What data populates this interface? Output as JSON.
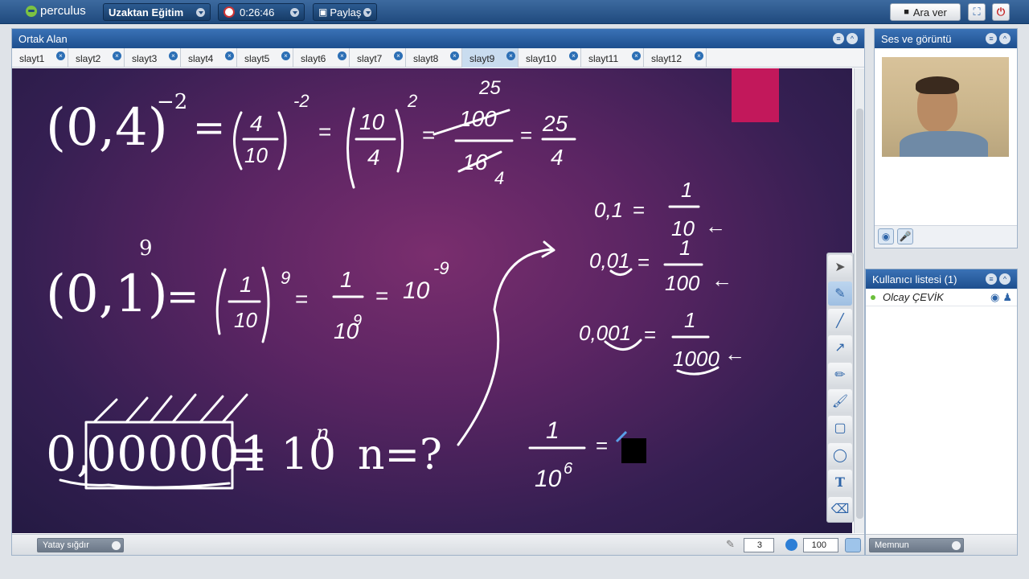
{
  "app": {
    "logo": "perculus"
  },
  "topbar": {
    "session_select": "Uzaktan Eğitim",
    "timer": "0:26:46",
    "share_label": "Paylaş",
    "break_label": "Ara ver"
  },
  "shared_area": {
    "title": "Ortak Alan",
    "tabs": [
      "slayt1",
      "slayt2",
      "slayt3",
      "slayt4",
      "slayt5",
      "slayt6",
      "slayt7",
      "slayt8",
      "slayt9",
      "slayt10",
      "slayt11",
      "slayt12"
    ],
    "active_tab": "slayt9",
    "fit_select": "Yatay sığdır",
    "pen_size": "3",
    "opacity": "100"
  },
  "slide": {
    "eq1_base": "(0,4)",
    "eq1_exp": "−2",
    "eq2_base": "(0,1)",
    "eq2_exp": "9",
    "eq3_left": "0,000001",
    "eq3_prefix": "0,",
    "eq3_digits": "000001",
    "eq3_right": "= 10",
    "eq3_exp": "n",
    "eq3_question": "n=?",
    "hand_equals": "=",
    "hand_frac1_num": "4",
    "hand_frac1_den": "10",
    "hand_exp_m2": "-2",
    "hand_frac2_num": "10",
    "hand_frac2_den": "4",
    "hand_exp_2": "2",
    "hand_frac3_num": "100",
    "hand_frac3_den": "16",
    "hand_25": "25",
    "hand_4": "4",
    "hand_frac4_num": "25",
    "hand_frac4_den": "4",
    "hand_frac5_num": "1",
    "hand_frac5_den": "10",
    "hand_exp_9": "9",
    "hand_frac6_num": "1",
    "hand_frac6_den": "10",
    "hand_10": "10",
    "hand_exp_m9": "-9",
    "hand_01": "0,1",
    "hand_001": "0,01",
    "hand_0001": "0,001",
    "hand_one": "1",
    "hand_den10": "10",
    "hand_den100": "100",
    "hand_den1000": "1000",
    "hand_arrow": "←",
    "hand_den106": "10",
    "hand_exp_6": "6"
  },
  "av_panel": {
    "title": "Ses ve görüntü"
  },
  "users_panel": {
    "title": "Kullanıcı listesi (1)",
    "users": [
      {
        "name": "Olcay ÇEVİK"
      }
    ]
  },
  "mood_select": "Memnun",
  "colors": {
    "accent": "#c2185b",
    "header": "#1e4f8e"
  }
}
